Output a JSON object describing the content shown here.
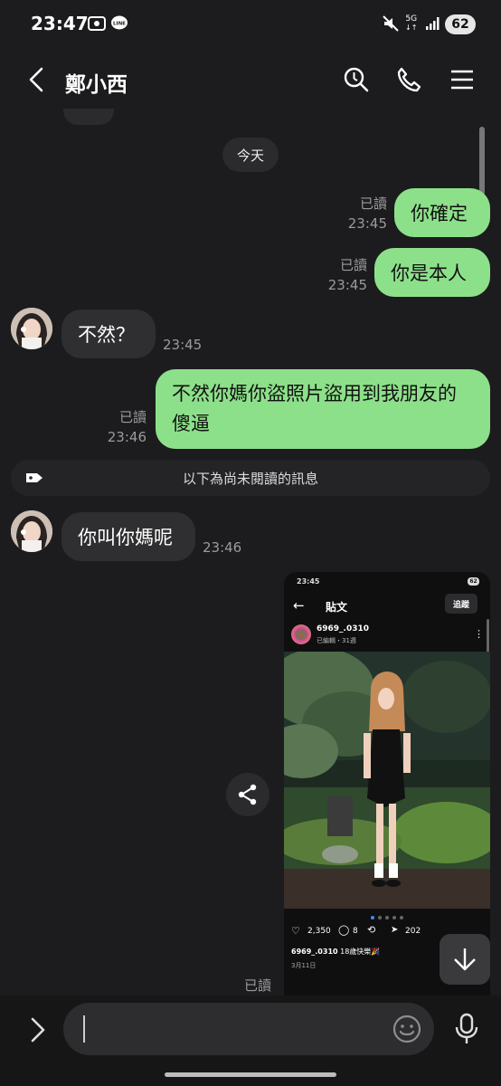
{
  "status_bar": {
    "time": "23:47",
    "network": "5G",
    "battery": "62"
  },
  "header": {
    "contact_name": "鄭小西"
  },
  "chat": {
    "date_label": "今天",
    "read_label": "已讀",
    "messages": [
      {
        "dir": "sent",
        "text": "你確定",
        "time": "23:45",
        "read": "已讀"
      },
      {
        "dir": "sent",
        "text": "你是本人",
        "time": "23:45",
        "read": "已讀"
      },
      {
        "dir": "received",
        "text": "不然？",
        "time": "23:45"
      },
      {
        "dir": "sent",
        "line1": "不然你媽你盜照片盜用到我朋友的",
        "line2": "傻逼",
        "time": "23:46",
        "read": "已讀"
      },
      {
        "dir": "received",
        "text": "你叫你媽呢",
        "time": "23:46"
      }
    ],
    "unread_divider": "以下為尚未閱讀的訊息",
    "image_message": {
      "read": "已讀",
      "screenshot": {
        "time": "23:45",
        "battery": "62",
        "title": "貼文",
        "follow_label": "追蹤",
        "username": "6969_.0310",
        "edited": "已編輯・31週",
        "likes": "2,350",
        "comments": "8",
        "shares": "202",
        "caption_user": "6969_.0310",
        "caption_text": "18歲快樂🎉",
        "date": "3月11日"
      }
    }
  },
  "input": {
    "placeholder": ""
  },
  "colors": {
    "background": "#1c1c1e",
    "sent_bubble": "#8de08a",
    "received_bubble": "#2f2f31"
  }
}
